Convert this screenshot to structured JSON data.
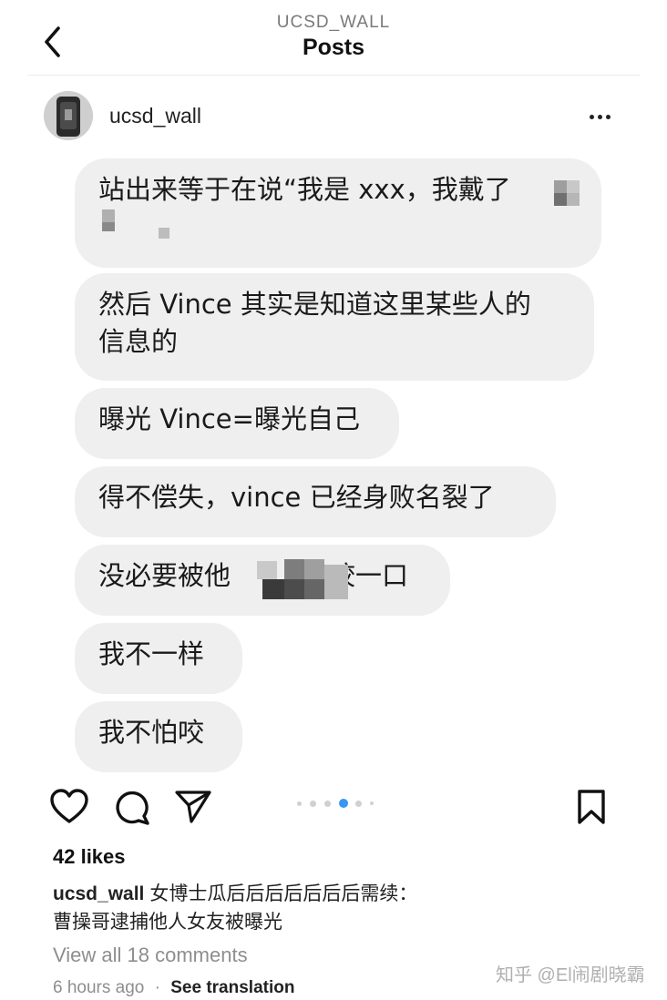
{
  "header": {
    "account": "UCSD_WALL",
    "title": "Posts",
    "back_icon": "chevron-left-icon"
  },
  "post": {
    "username": "ucsd_wall",
    "more_icon": "more-horizontal-icon",
    "image": {
      "messages": [
        {
          "line1": "站出来等于在说“我是 xxx，我戴了",
          "line2": ""
        },
        {
          "line1": "然后 Vince 其实是知道这里某些人的",
          "line2": "信息的"
        },
        {
          "line1": "曝光 Vince=曝光自己",
          "line2": ""
        },
        {
          "line1": "得不偿失，vince 已经身败名裂了",
          "line2": ""
        },
        {
          "line1": "没必要被他",
          "line1b": "咬一口",
          "line2": ""
        },
        {
          "line1": "我不一样",
          "line2": ""
        },
        {
          "line1": "我不怕咬",
          "line2": ""
        }
      ]
    },
    "actions": {
      "like_icon": "heart-icon",
      "comment_icon": "comment-icon",
      "share_icon": "send-icon",
      "save_icon": "bookmark-icon",
      "carousel_active_index": 3,
      "carousel_count": 6
    },
    "likes": "42 likes",
    "caption": {
      "user": "ucsd_wall",
      "text": "女博士瓜后后后后后后后需续：",
      "text2": "曹操哥逮捕他人女友被曝光"
    },
    "view_comments": "View all 18 comments",
    "time": "6 hours ago",
    "separator": "·",
    "see_translation": "See translation",
    "watermark": "知乎 @El闹剧晓霸"
  }
}
